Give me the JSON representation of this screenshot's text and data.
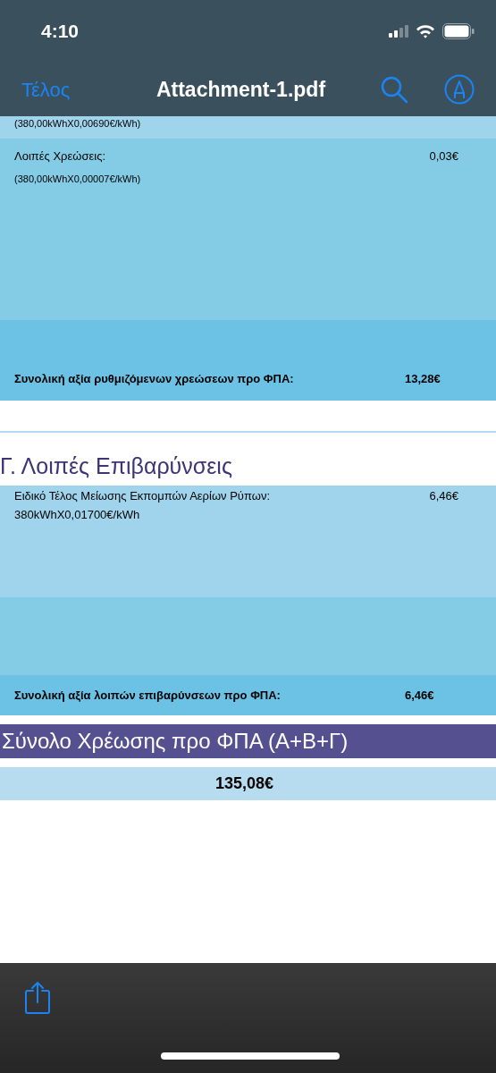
{
  "status_bar": {
    "time": "4:10"
  },
  "nav": {
    "back": "Τέλος",
    "title": "Attachment-1.pdf"
  },
  "document": {
    "cut_detail": "(380,00kWhX0,00690€/kWh)",
    "other_charges": {
      "label": "Λοιπές Χρεώσεις:",
      "value": "0,03€",
      "detail": "(380,00kWhX0,00007€/kWh)"
    },
    "regulated_total": {
      "label": "Συνολική αξία ρυθμιζόμενων χρεώσεων προ ΦΠΑ:",
      "value": "13,28€"
    },
    "section_heading": "Γ. Λοιπές Επιβαρύνσεις",
    "levy": {
      "label": "Ειδικό Τέλος Μείωσης Εκπομπών Αερίων Ρύπων:",
      "value": "6,46€",
      "detail": "380kWhX0,01700€/kWh"
    },
    "levy_total": {
      "label": "Συνολική αξία λοιπών επιβαρύνσεων προ ΦΠΑ:",
      "value": "6,46€"
    },
    "grand_total_heading": "Σύνολο Χρέωσης προ ΦΠΑ (Α+Β+Γ)",
    "grand_total_value": "135,08€"
  }
}
